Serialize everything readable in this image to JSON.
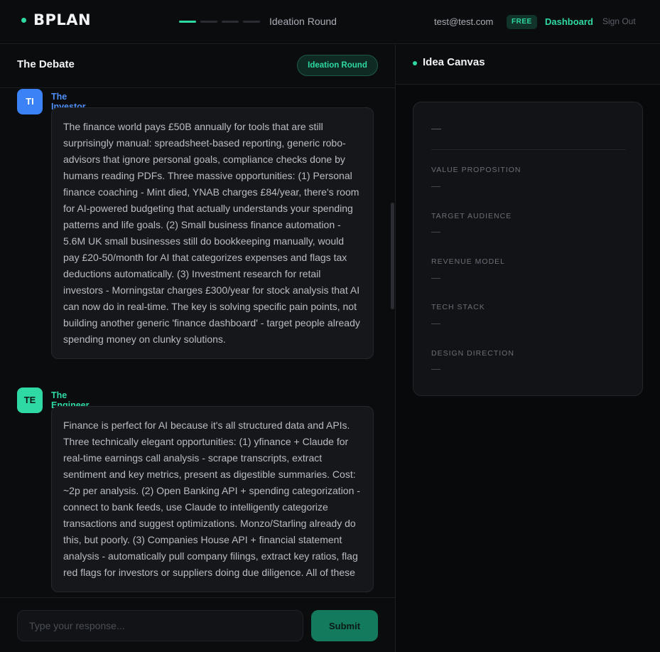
{
  "app": {
    "brand": "BPLAN",
    "progress_steps": 4,
    "progress_active": 1,
    "round_label": "Ideation Round"
  },
  "user": {
    "email": "test@test.com",
    "plan": "FREE",
    "dashboard_label": "Dashboard",
    "signout_label": "Sign Out"
  },
  "debate": {
    "title": "The Debate",
    "round_badge": "Ideation Round",
    "messages": [
      {
        "initials": "TI",
        "sender": "The Investor",
        "text": "The finance world pays £50B annually for tools that are still surprisingly manual: spreadsheet-based reporting, generic robo-advisors that ignore personal goals, compliance checks done by humans reading PDFs. Three massive opportunities: (1) Personal finance coaching - Mint died, YNAB charges £84/year, there's room for AI-powered budgeting that actually understands your spending patterns and life goals. (2) Small business finance automation - 5.6M UK small businesses still do bookkeeping manually, would pay £20-50/month for AI that categorizes expenses and flags tax deductions automatically. (3) Investment research for retail investors - Morningstar charges £300/year for stock analysis that AI can now do in real-time. The key is solving specific pain points, not building another generic 'finance dashboard' - target people already spending money on clunky solutions."
      },
      {
        "initials": "TE",
        "sender": "The Engineer",
        "text": "Finance is perfect for AI because it's all structured data and APIs. Three technically elegant opportunities: (1) yfinance + Claude for real-time earnings call analysis - scrape transcripts, extract sentiment and key metrics, present as digestible summaries. Cost: ~2p per analysis. (2) Open Banking API + spending categorization - connect to bank feeds, use Claude to intelligently categorize transactions and suggest optimizations. Monzo/Starling already do this, but poorly. (3) Companies House API + financial statement analysis - automatically pull company filings, extract key ratios, flag red flags for investors or suppliers doing due diligence. All of these"
      }
    ]
  },
  "composer": {
    "placeholder": "Type your response...",
    "value": "",
    "submit_label": "Submit"
  },
  "canvas": {
    "title": "Idea Canvas",
    "idea_title": "—",
    "fields": [
      {
        "label": "VALUE PROPOSITION",
        "value": "—"
      },
      {
        "label": "TARGET AUDIENCE",
        "value": "—"
      },
      {
        "label": "REVENUE MODEL",
        "value": "—"
      },
      {
        "label": "TECH STACK",
        "value": "—"
      },
      {
        "label": "DESIGN DIRECTION",
        "value": "—"
      }
    ]
  },
  "colors": {
    "accent": "#2fd9a4",
    "investor": "#3b82f6",
    "background": "#0a0b0d"
  }
}
